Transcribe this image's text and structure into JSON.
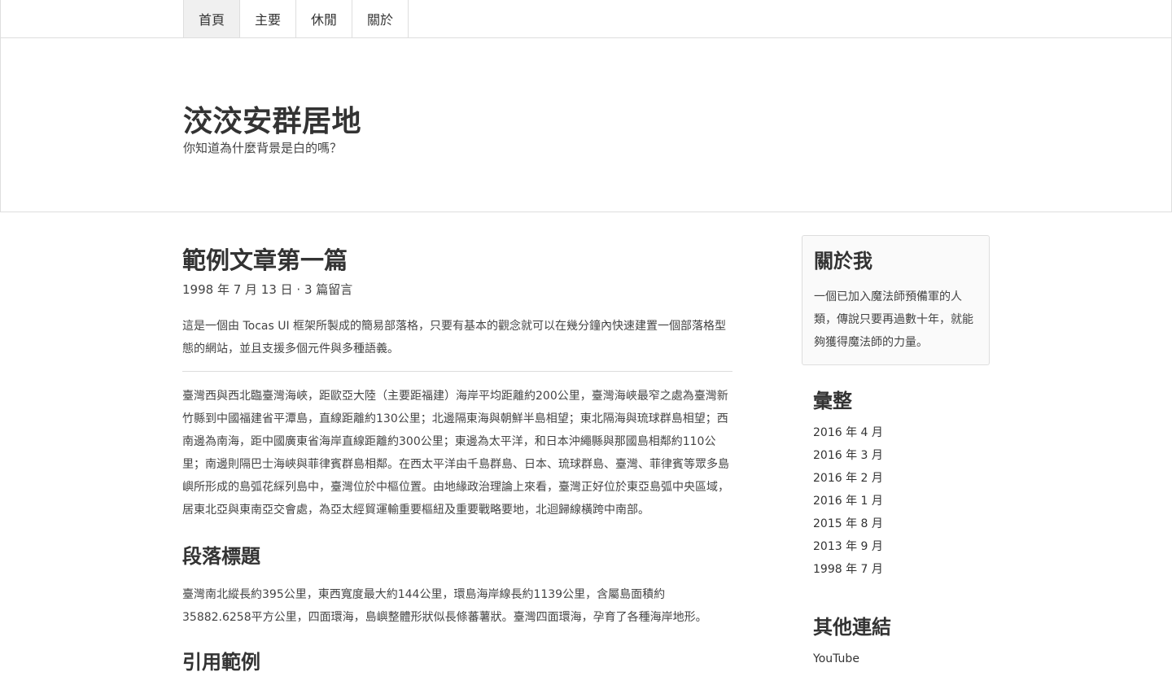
{
  "nav": {
    "items": [
      {
        "label": "首頁"
      },
      {
        "label": "主要"
      },
      {
        "label": "休閒"
      },
      {
        "label": "關於"
      }
    ]
  },
  "header": {
    "title": "洨洨安群居地",
    "subtitle": "你知道為什麼背景是白的嗎？"
  },
  "article": {
    "title": "範例文章第一篇",
    "meta": "1998 年 7 月 13 日 · 3 篇留言",
    "intro": "這是一個由 Tocas UI 框架所製成的簡易部落格，只要有基本的觀念就可以在幾分鐘內快速建置一個部落格型態的網站，並且支援多個元件與多種語義。",
    "paragraph1": "臺灣西與西北臨臺灣海峽，距歐亞大陸（主要距福建）海岸平均距離約200公里，臺灣海峽最窄之處為臺灣新竹縣到中國福建省平潭島，直線距離約130公里；北邊隔東海與朝鮮半島相望；東北隔海與琉球群島相望；西南邊為南海，距中國廣東省海岸直線距離約300公里；東邊為太平洋，和日本沖繩縣與那國島相鄰約110公里；南邊則隔巴士海峽與菲律賓群島相鄰。在西太平洋由千島群島、日本、琉球群島、臺灣、菲律賓等眾多島嶼所形成的島弧花綵列島中，臺灣位於中樞位置。由地緣政治理論上來看，臺灣正好位於東亞島弧中央區域，居東北亞與東南亞交會處，為亞太經貿運輸重要樞紐及重要戰略要地，北迴歸線橫跨中南部。",
    "heading1": "段落標題",
    "paragraph2": "臺灣南北縱長約395公里，東西寬度最大約144公里，環島海岸線長約1139公里，含屬島面積約35882.6258平方公里，四面環海，島嶼整體形狀似長條蕃薯狀。臺灣四面環海，孕育了各種海岸地形。",
    "heading2": "引用範例"
  },
  "sidebar": {
    "about": {
      "title": "關於我",
      "text": "一個已加入魔法師預備軍的人類，傳說只要再過數十年，就能夠獲得魔法師的力量。"
    },
    "archive": {
      "title": "彙整",
      "items": [
        "2016 年 4 月",
        "2016 年 3 月",
        "2016 年 2 月",
        "2016 年 1 月",
        "2015 年 8 月",
        "2013 年 9 月",
        "1998 年 7 月"
      ]
    },
    "links": {
      "title": "其他連結",
      "items": [
        "YouTube"
      ]
    }
  }
}
